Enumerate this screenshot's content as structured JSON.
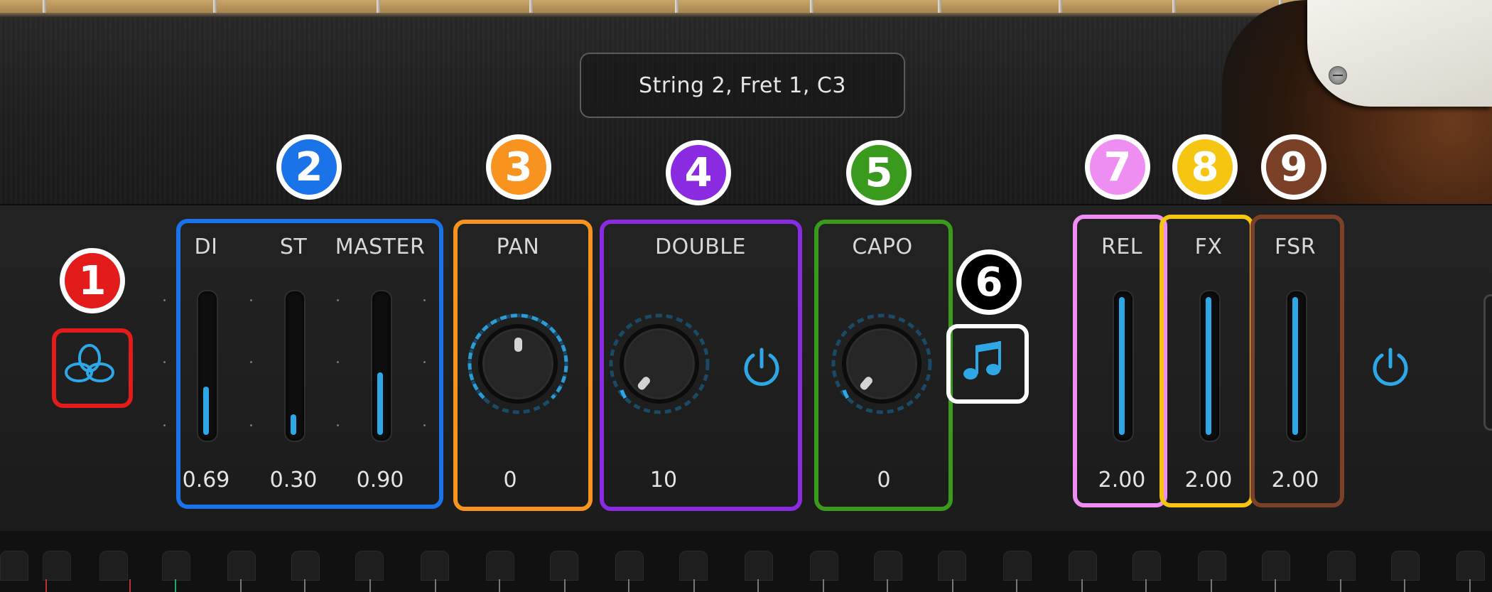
{
  "display": {
    "note": "String 2, Fret 1, C3"
  },
  "colors": {
    "accent": "#2ea7e6",
    "group1": "#e41b1b",
    "group2": "#1a73e8",
    "group3": "#f7931e",
    "group4": "#8a2be2",
    "group5": "#3a9a1e",
    "group6": "#ffffff",
    "group7": "#ef8ef2",
    "group8": "#f6c511",
    "group9": "#7b4128"
  },
  "callouts": {
    "c1": "1",
    "c2": "2",
    "c3": "3",
    "c4": "4",
    "c5": "5",
    "c6": "6",
    "c7": "7",
    "c8": "8",
    "c9": "9"
  },
  "mix": {
    "di": {
      "label": "DI",
      "value": "0.69",
      "level": 0.69
    },
    "st": {
      "label": "ST",
      "value": "0.30",
      "level": 0.3
    },
    "master": {
      "label": "MASTER",
      "value": "0.90",
      "level": 0.9
    }
  },
  "pan": {
    "label": "PAN",
    "value": "0"
  },
  "double": {
    "label": "DOUBLE",
    "value": "10",
    "icon": "power-icon"
  },
  "capo": {
    "label": "CAPO",
    "value": "0"
  },
  "articulation": {
    "icon": "music-note-icon"
  },
  "envelope": {
    "rel": {
      "label": "REL",
      "value": "2.00",
      "level": 1.0
    },
    "fx": {
      "label": "FX",
      "value": "2.00",
      "level": 1.0
    },
    "fsr": {
      "label": "FSR",
      "value": "2.00",
      "level": 1.0
    }
  },
  "options": {
    "icon": "triple-loop-icon"
  },
  "power": {
    "icon": "power-icon"
  }
}
